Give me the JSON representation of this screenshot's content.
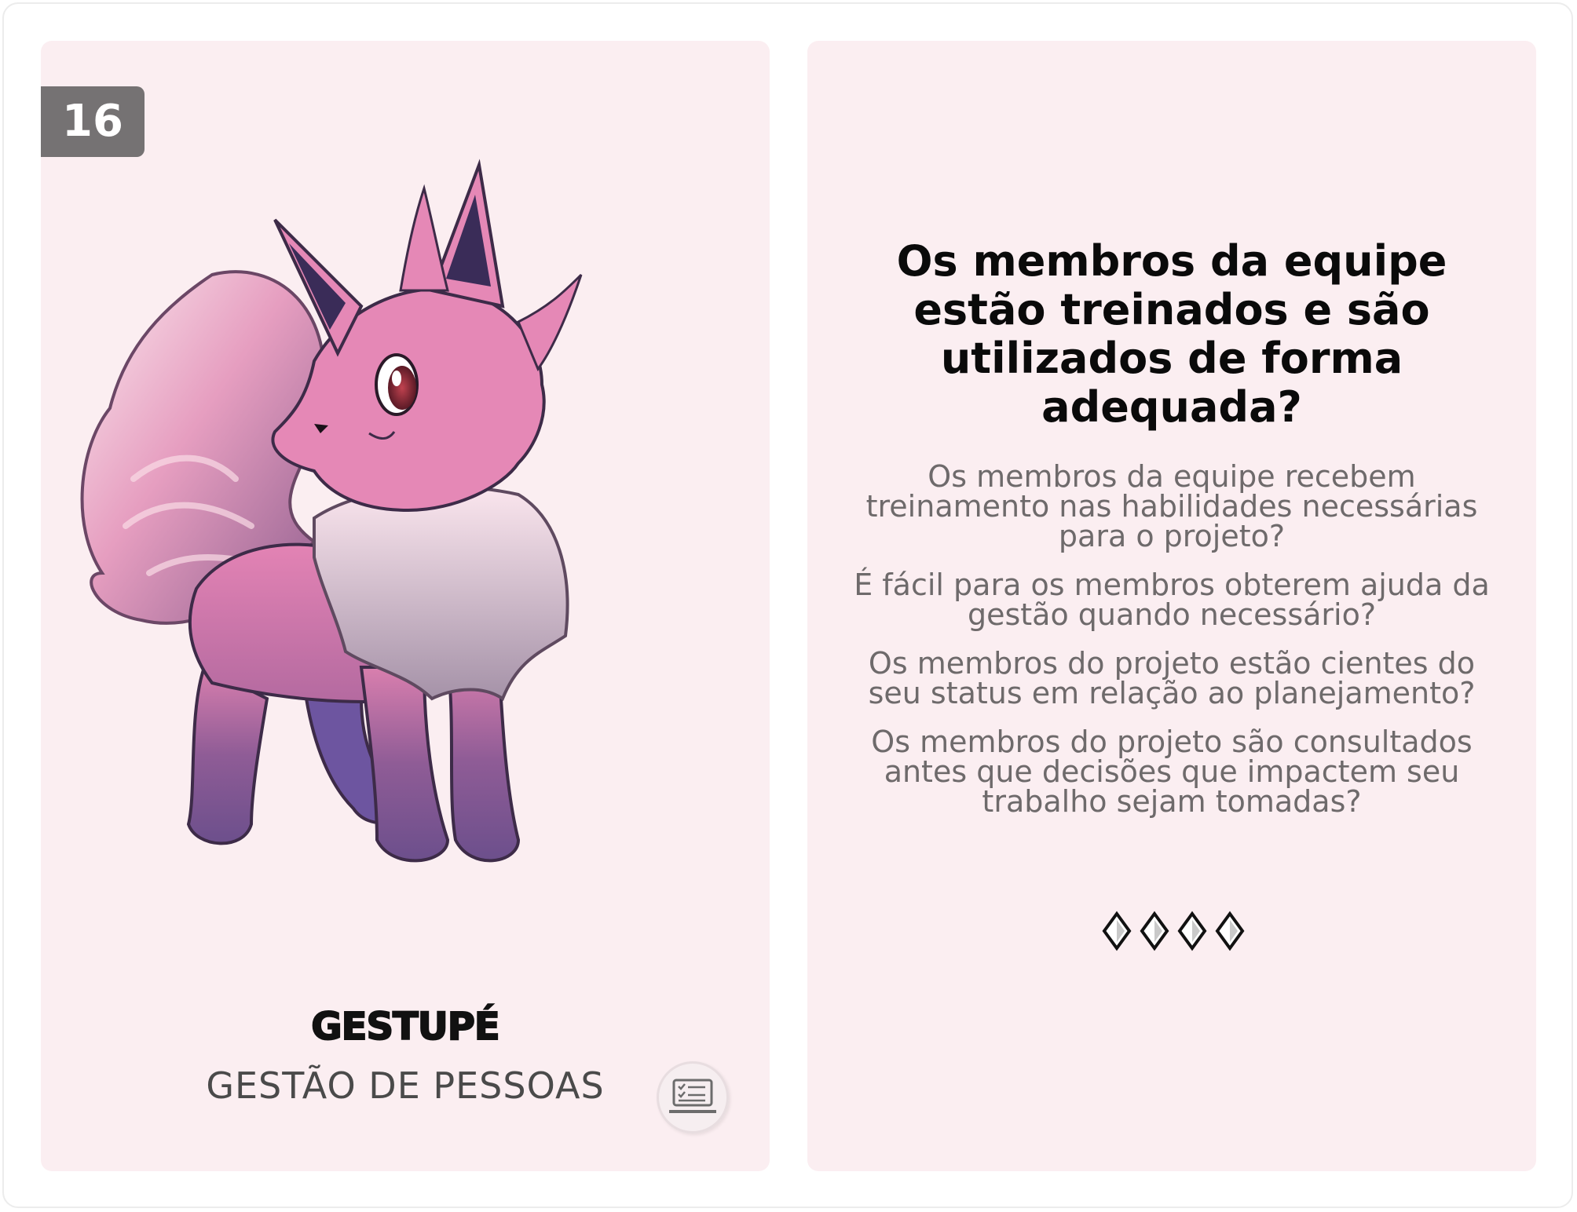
{
  "card_number": "16",
  "creature": {
    "name": "GESTUPÉ",
    "category": "GESTÃO DE PESSOAS",
    "image_icon": "pink-fox-creature-illustration",
    "category_icon": "laptop-checklist-icon"
  },
  "question": {
    "title": "Os membros da equipe estão treinados e são utilizados de forma adequada?",
    "sub_questions": [
      "Os membros da equipe recebem treinamento nas habilidades necessárias para o projeto?",
      "É fácil para os membros obterem ajuda da gestão quando necessário?",
      "Os membros do projeto estão cientes do seu status em relação ao planejamento?",
      "Os membros do projeto são consultados antes que decisões que impactem seu trabalho sejam tomadas?"
    ],
    "rating_icon": "diamond-icon",
    "rating_count": 4
  },
  "colors": {
    "card_background": "#fbeef1",
    "badge": "#757273",
    "title": "#0a0a0a",
    "subtext": "#6e6a6b"
  }
}
